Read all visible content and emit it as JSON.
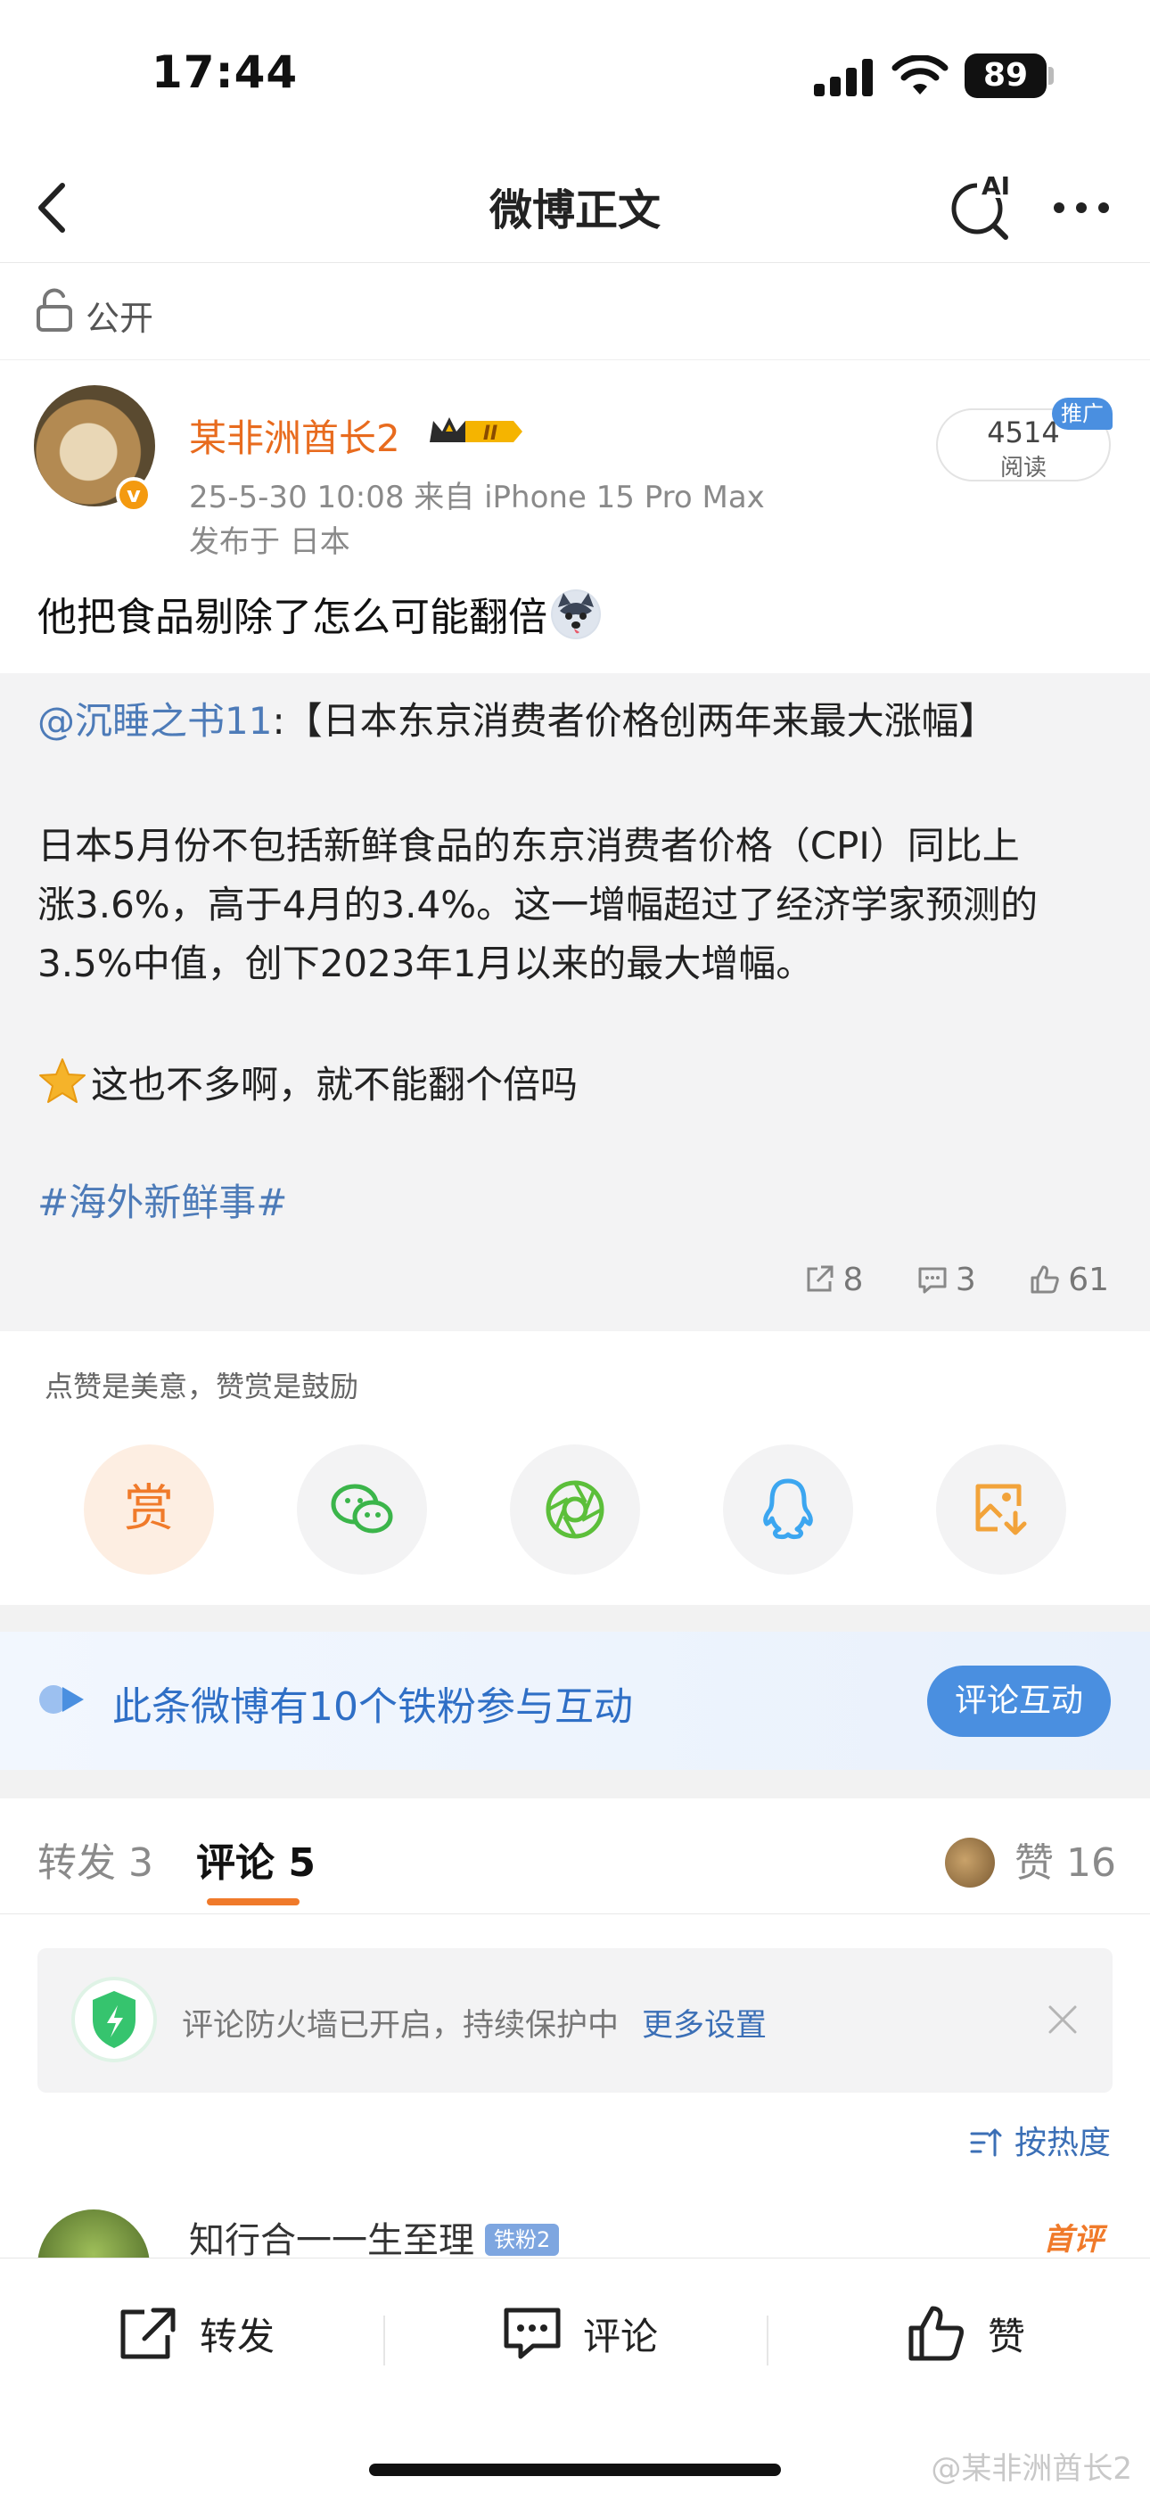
{
  "status_bar": {
    "time": "17:44",
    "battery": "89"
  },
  "nav": {
    "title": "微博正文",
    "ai_label": "AI"
  },
  "visibility": {
    "label": "公开"
  },
  "post": {
    "username": "某非洲酋长2",
    "vip_level": "II",
    "meta": "25-5-30 10:08  来自 iPhone 15 Pro Max",
    "location": "发布于 日本",
    "reads_count": "4514",
    "reads_label": "阅读",
    "promo_tag": "推广",
    "text": "他把食品剔除了怎么可能翻倍"
  },
  "repost": {
    "mention": "@沉睡之书11",
    "headline": ":【日本东京消费者价格创两年来最大涨幅】",
    "body_line1": " 日本5月份不包括新鲜食品的东京消费者价格（CPI）同比上",
    "body_line2": "涨3.6%，高于4月的3.4%。这一增幅超过了经济学家预测的",
    "body_line3": "3.5%中值，创下2023年1月以来的最大增幅。",
    "comment": "这也不多啊，就不能翻个倍吗",
    "hashtag": "#海外新鲜事#",
    "shares": "8",
    "comments": "3",
    "likes": "61"
  },
  "share": {
    "hint": "点赞是美意，赞赏是鼓励",
    "reward_label": "赏"
  },
  "fans": {
    "text": "此条微博有10个铁粉参与互动",
    "button": "评论互动"
  },
  "tabs": {
    "repost": "转发 3",
    "comments": "评论 5",
    "likes": "赞 16"
  },
  "firewall": {
    "text": "评论防火墙已开启，持续保护中",
    "link": "更多设置"
  },
  "sort": {
    "label": "按热度"
  },
  "comment": {
    "username": "知行合一一生至理",
    "fan_badge": "铁粉2",
    "first_tag": "首评"
  },
  "bottom": {
    "repost": "转发",
    "comment": "评论",
    "like": "赞",
    "watermark": "@某非洲酋长2"
  },
  "colors": {
    "accent_orange": "#f07a2a",
    "link_blue": "#4d7bb8",
    "button_blue": "#4a8fe0"
  }
}
